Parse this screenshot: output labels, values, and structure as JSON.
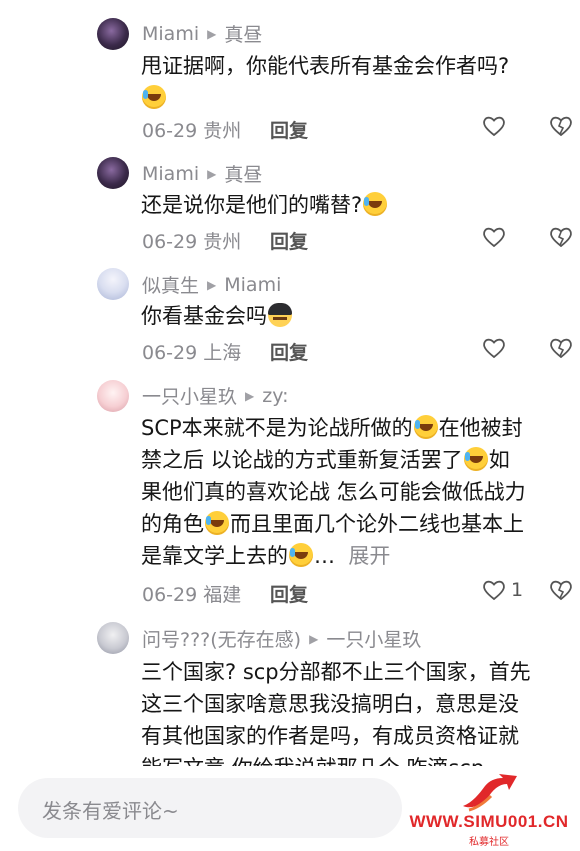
{
  "comments": [
    {
      "author": "Miami",
      "reply_to": "真昼",
      "text_line1": "甩证据啊，你能代表所有基金会作者吗?",
      "date": "06-29",
      "location": "贵州",
      "reply_label": "回复"
    },
    {
      "author": "Miami",
      "reply_to": "真昼",
      "text_line1": "还是说你是他们的嘴替?",
      "date": "06-29",
      "location": "贵州",
      "reply_label": "回复"
    },
    {
      "author": "似真生",
      "reply_to": "Miami",
      "text_line1": "你看基金会吗",
      "date": "06-29",
      "location": "上海",
      "reply_label": "回复"
    },
    {
      "author": "一只小星玖",
      "reply_to": "zy:",
      "lines": [
        "SCP本来就不是为论战所做的",
        "在他被封",
        "禁之后 以论战的方式重新复活罢了",
        "如",
        "果他们真的喜欢论战 怎么可能会做低战力",
        "的角色",
        "而且里面几个论外二线也基本上",
        "是靠文学上去的",
        "…",
        "展开"
      ],
      "date": "06-29",
      "location": "福建",
      "reply_label": "回复",
      "like_count": "1"
    },
    {
      "author": "问号???(无存在感)",
      "reply_to": "一只小星玖",
      "lines": [
        "三个国家? scp分部都不止三个国家，首先",
        "这三个国家啥意思我没搞明白，意思是没",
        "有其他国家的作者是吗，有成员资格证就",
        "能写文章 你给我说就那几个 咋滴scp一"
      ]
    }
  ],
  "input": {
    "placeholder": "发条有爱评论~"
  },
  "watermark": {
    "url": "WWW.SIMU001.CN",
    "sub": "私募社区"
  },
  "colors": {
    "meta": "#8a8a8f",
    "text": "#161616",
    "watermark": "#e1282a"
  }
}
